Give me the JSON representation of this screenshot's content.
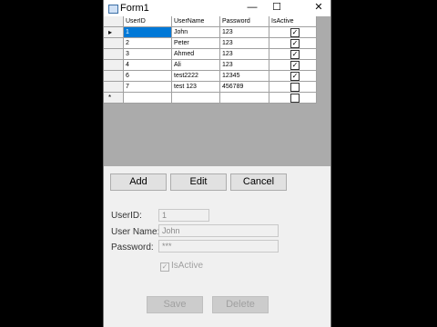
{
  "window": {
    "title": "Form1",
    "minimize": "—",
    "maximize": "☐",
    "close": "✕"
  },
  "grid": {
    "columns": [
      "UserID",
      "UserName",
      "Password",
      "IsActive"
    ],
    "rows": [
      {
        "indicator": "▸",
        "userid": "1",
        "username": "John",
        "password": "123",
        "active": "✓"
      },
      {
        "indicator": "",
        "userid": "2",
        "username": "Peter",
        "password": "123",
        "active": "✓"
      },
      {
        "indicator": "",
        "userid": "3",
        "username": "Ahmed",
        "password": "123",
        "active": "✓"
      },
      {
        "indicator": "",
        "userid": "4",
        "username": "Ali",
        "password": "123",
        "active": "✓"
      },
      {
        "indicator": "",
        "userid": "6",
        "username": "test2222",
        "password": "12345",
        "active": "✓"
      },
      {
        "indicator": "",
        "userid": "7",
        "username": "test 123",
        "password": "456789",
        "active": ""
      },
      {
        "indicator": "*",
        "userid": "",
        "username": "",
        "password": "",
        "active": ""
      }
    ]
  },
  "buttons": {
    "add": "Add",
    "edit": "Edit",
    "cancel": "Cancel",
    "save": "Save",
    "delete": "Delete"
  },
  "form": {
    "userid_label": "UserID:",
    "userid_value": "1",
    "username_label": "User Name:",
    "username_value": "John",
    "password_label": "Password:",
    "password_value": "***",
    "isactive_label": "IsActive",
    "isactive_check": "✓"
  }
}
